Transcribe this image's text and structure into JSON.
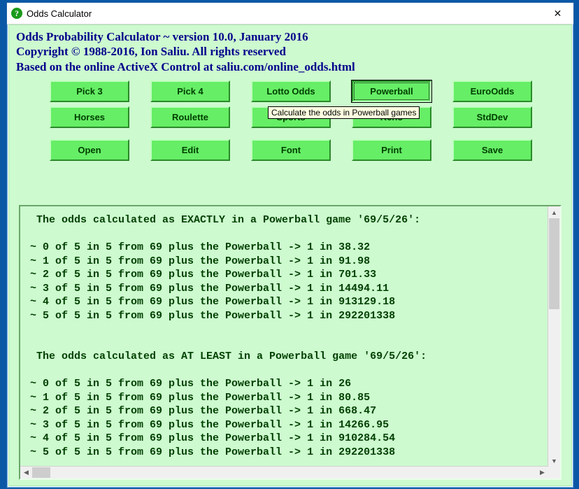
{
  "window": {
    "title": "Odds Calculator",
    "icon_glyph": "?"
  },
  "header": {
    "line1": "Odds Probability Calculator ~ version 10.0, January 2016",
    "line2": "Copyright © 1988-2016, Ion Saliu. All rights reserved",
    "line3": "Based on the online ActiveX Control at saliu.com/online_odds.html"
  },
  "buttons": {
    "row1": [
      "Pick 3",
      "Pick 4",
      "Lotto Odds",
      "Powerball",
      "EuroOdds"
    ],
    "row2": [
      "Horses",
      "Roulette",
      "Sports",
      "Keno",
      "StdDev"
    ],
    "row3": [
      "Open",
      "Edit",
      "Font",
      "Print",
      "Save"
    ]
  },
  "focused_button": "Powerball",
  "tooltip": "Calculate the odds in Powerball games",
  "output": " The odds calculated as EXACTLY in a Powerball game '69/5/26':\n\n~ 0 of 5 in 5 from 69 plus the Powerball -> 1 in 38.32\n~ 1 of 5 in 5 from 69 plus the Powerball -> 1 in 91.98\n~ 2 of 5 in 5 from 69 plus the Powerball -> 1 in 701.33\n~ 3 of 5 in 5 from 69 plus the Powerball -> 1 in 14494.11\n~ 4 of 5 in 5 from 69 plus the Powerball -> 1 in 913129.18\n~ 5 of 5 in 5 from 69 plus the Powerball -> 1 in 292201338\n\n\n The odds calculated as AT LEAST in a Powerball game '69/5/26':\n\n~ 0 of 5 in 5 from 69 plus the Powerball -> 1 in 26\n~ 1 of 5 in 5 from 69 plus the Powerball -> 1 in 80.85\n~ 2 of 5 in 5 from 69 plus the Powerball -> 1 in 668.47\n~ 3 of 5 in 5 from 69 plus the Powerball -> 1 in 14266.95\n~ 4 of 5 in 5 from 69 plus the Powerball -> 1 in 910284.54\n~ 5 of 5 in 5 from 69 plus the Powerball -> 1 in 292201338"
}
